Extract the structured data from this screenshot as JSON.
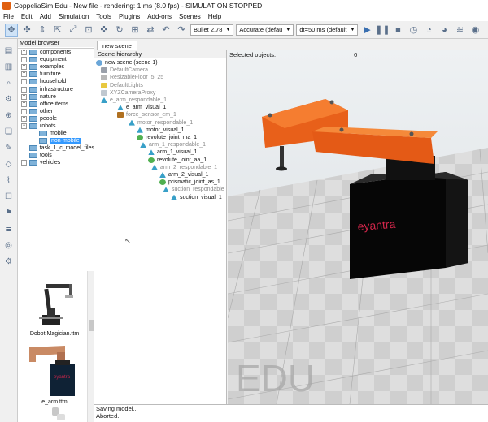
{
  "window": {
    "title": "CoppeliaSim Edu - New file - rendering: 1 ms (8.0 fps) - SIMULATION STOPPED"
  },
  "menu": [
    "File",
    "Edit",
    "Add",
    "Simulation",
    "Tools",
    "Plugins",
    "Add-ons",
    "Scenes",
    "Help"
  ],
  "toolbar": {
    "engine": "Bullet 2.78",
    "accuracy": "Accurate (defau",
    "timestep": "dt=50 ms (default"
  },
  "model_browser": {
    "title": "Model browser",
    "items": [
      {
        "label": "components",
        "expander": "+"
      },
      {
        "label": "equipment",
        "expander": "+"
      },
      {
        "label": "examples",
        "expander": "+"
      },
      {
        "label": "furniture",
        "expander": "+"
      },
      {
        "label": "household",
        "expander": "+"
      },
      {
        "label": "infrastructure",
        "expander": "+"
      },
      {
        "label": "nature",
        "expander": "+"
      },
      {
        "label": "office items",
        "expander": "+"
      },
      {
        "label": "other",
        "expander": "+"
      },
      {
        "label": "people",
        "expander": "+"
      },
      {
        "label": "robots",
        "expander": "−"
      },
      {
        "label": "mobile",
        "expander": ""
      },
      {
        "label": "non-mobile",
        "expander": "",
        "selected": true
      },
      {
        "label": "task_1_c_model_files",
        "expander": ""
      },
      {
        "label": "tools",
        "expander": ""
      },
      {
        "label": "vehicles",
        "expander": "+"
      }
    ],
    "thumbnails": [
      "Dobot Magician.ttm",
      "e_arm.ttm"
    ]
  },
  "tab": "new scene",
  "hierarchy": {
    "title": "Scene hierarchy",
    "nodes": [
      {
        "label": "new scene (scene 1)",
        "icon": "scene",
        "gray": false
      },
      {
        "label": "DefaultCamera",
        "icon": "cam",
        "gray": true
      },
      {
        "label": "ResizableFloor_5_25",
        "icon": "floor",
        "gray": true
      },
      {
        "label": "DefaultLights",
        "icon": "light",
        "gray": true
      },
      {
        "label": "XYZCameraProxy",
        "icon": "dummy",
        "gray": true
      },
      {
        "label": "e_arm_respondable_1",
        "icon": "shape",
        "gray": true
      },
      {
        "label": "e_arm_visual_1",
        "icon": "shape",
        "gray": false
      },
      {
        "label": "force_sensor_em_1",
        "icon": "force",
        "gray": true
      },
      {
        "label": "motor_respondable_1",
        "icon": "shape",
        "gray": true
      },
      {
        "label": "motor_visual_1",
        "icon": "shape",
        "gray": false
      },
      {
        "label": "revolute_joint_ma_1",
        "icon": "joint",
        "gray": false
      },
      {
        "label": "arm_1_respondable_1",
        "icon": "shape",
        "gray": true
      },
      {
        "label": "arm_1_visual_1",
        "icon": "shape",
        "gray": false
      },
      {
        "label": "revolute_joint_aa_1",
        "icon": "joint",
        "gray": false
      },
      {
        "label": "arm_2_respondable_1",
        "icon": "shape",
        "gray": true
      },
      {
        "label": "arm_2_visual_1",
        "icon": "shape",
        "gray": false
      },
      {
        "label": "prismatic_joint_as_1",
        "icon": "joint",
        "gray": false
      },
      {
        "label": "suction_respondable_1",
        "icon": "shape",
        "gray": true
      },
      {
        "label": "suction_visual_1",
        "icon": "shape",
        "gray": false
      }
    ]
  },
  "viewport": {
    "selected_label": "Selected objects:",
    "selected_count": "0",
    "watermark": "EDU",
    "brand": "eyantra"
  },
  "status": {
    "lines": [
      "Saving model...",
      "Aborted."
    ]
  }
}
